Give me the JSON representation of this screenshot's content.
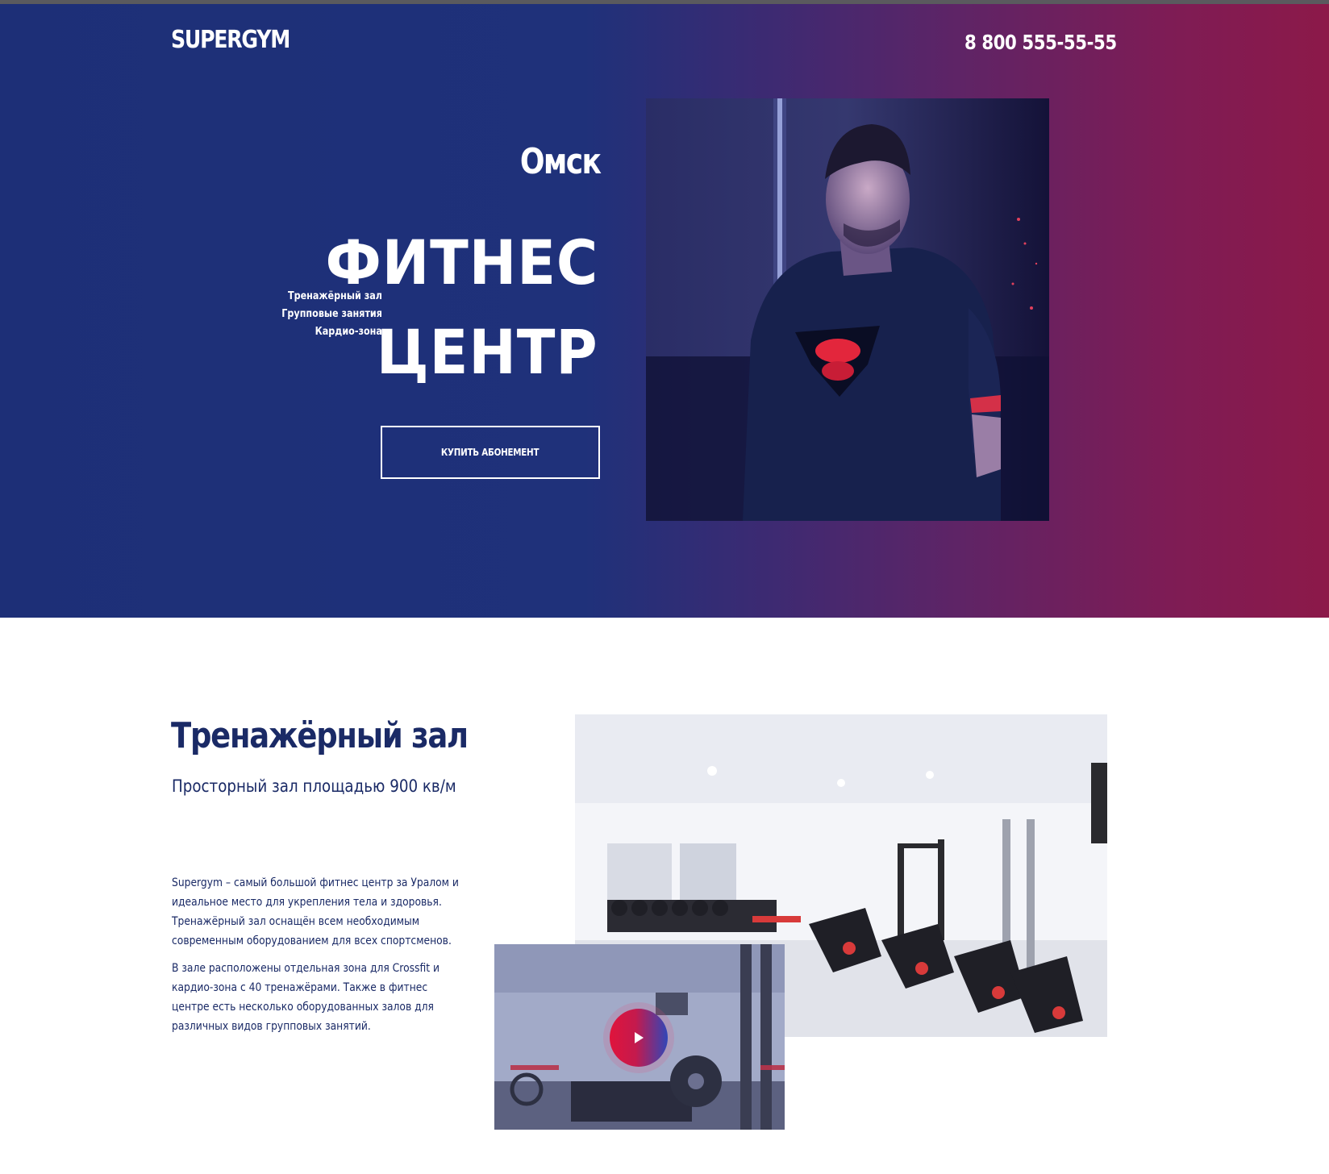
{
  "header": {
    "logo": "SUPERGYM",
    "phone": "8 800 555-55-55"
  },
  "hero": {
    "city": "Омск",
    "headline_line1": "ФИТНЕС",
    "headline_line2": "ЦЕНТР",
    "features": [
      "Тренажёрный зал",
      "Групповые занятия",
      "Кардио-зона"
    ],
    "cta_label": "КУПИТЬ АБОНЕМЕНТ"
  },
  "gym_section": {
    "title": "Тренажёрный зал",
    "subtitle": "Просторный зал площадью 900 кв/м",
    "paragraph1": "Supergym – самый большой фитнес центр за Уралом и идеальное место для укрепления тела и здоровья. Тренажёрный зал оснащён всем необходимым современным оборудованием для всех спортсменов.",
    "paragraph2": "В зале расположены отдельная зона для Crossfit и кардио-зона с 40 тренажёрами. Также в фитнес центре есть несколько оборудованных залов для различных видов групповых занятий."
  },
  "colors": {
    "gradient_start": "#1d2f77",
    "gradient_end": "#8c1949",
    "heading_text": "#1a2a66",
    "play_red": "#e0143c",
    "play_blue": "#3046b8"
  },
  "icons": {
    "play": "play-icon"
  }
}
